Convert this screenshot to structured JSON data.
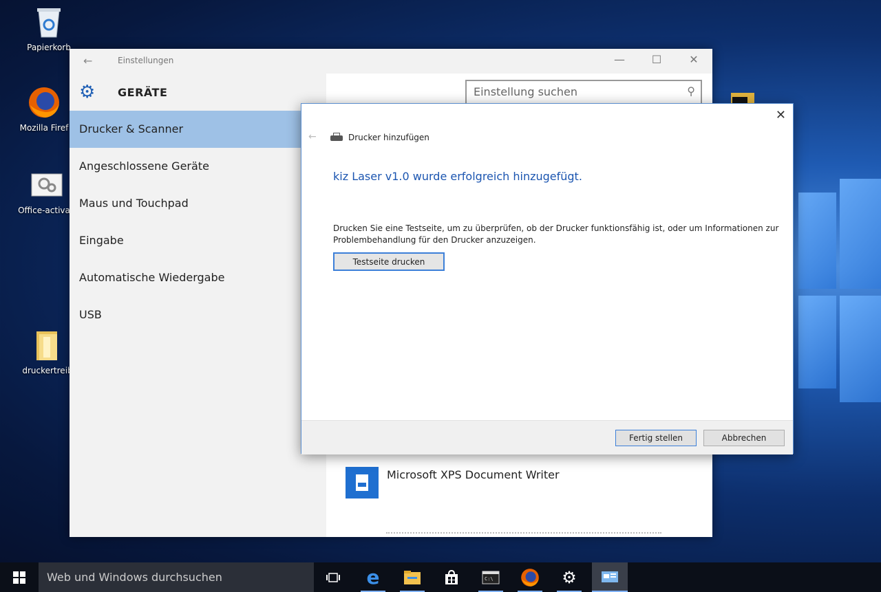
{
  "desktop": {
    "icons": [
      {
        "label": "Papierkorb"
      },
      {
        "label": "Mozilla Firef"
      },
      {
        "label": "Office-activati"
      },
      {
        "label": "druckertreib"
      }
    ]
  },
  "settings": {
    "back_icon": "back-arrow-icon",
    "title": "Einstellungen",
    "section_title": "GERÄTE",
    "search_placeholder": "Einstellung suchen",
    "nav_items": [
      {
        "label": "Drucker & Scanner"
      },
      {
        "label": "Angeschlossene Geräte"
      },
      {
        "label": "Maus und Touchpad"
      },
      {
        "label": "Eingabe"
      },
      {
        "label": "Automatische Wiedergabe"
      },
      {
        "label": "USB"
      }
    ],
    "printers": [
      {
        "label": "Microsoft XPS Document Writer"
      }
    ]
  },
  "dialog": {
    "title": "Drucker hinzufügen",
    "success_message": "kiz Laser v1.0 wurde erfolgreich hinzugefügt.",
    "description": "Drucken Sie eine Testseite, um zu überprüfen, ob der Drucker funktionsfähig ist, oder um Informationen zur Problembehandlung für den Drucker anzuzeigen.",
    "test_button": "Testseite drucken",
    "finish_button": "Fertig stellen",
    "cancel_button": "Abbrechen"
  },
  "taskbar": {
    "search_placeholder": "Web und Windows durchsuchen"
  }
}
